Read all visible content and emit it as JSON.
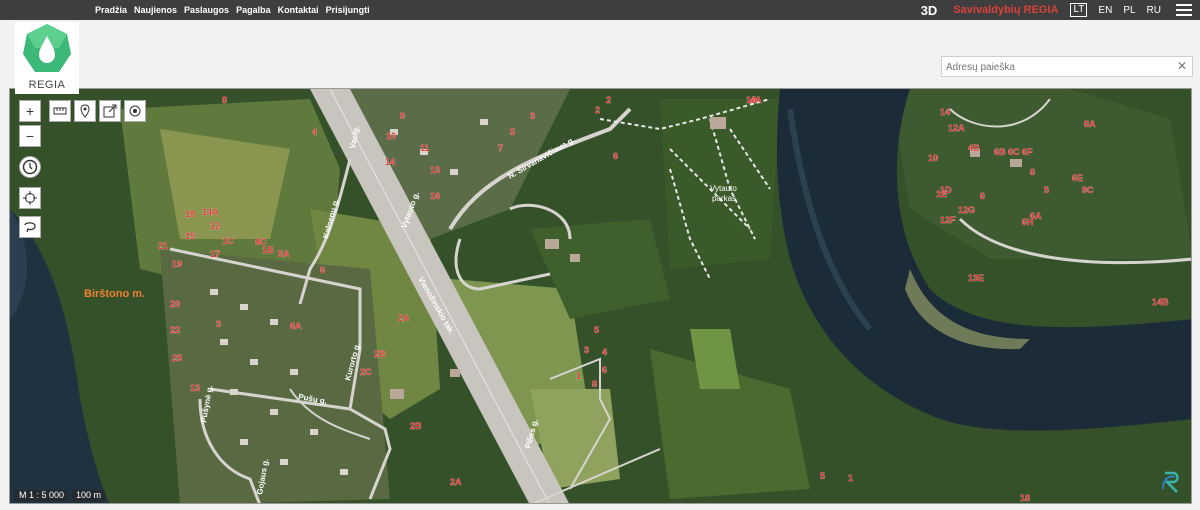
{
  "nav": {
    "items": [
      "Pradžia",
      "Naujienos",
      "Paslaugos",
      "Pagalba",
      "Kontaktai",
      "Prisijungti"
    ]
  },
  "topbar": {
    "btn_3d": "3D",
    "brand": "Savivaldybių REGIA",
    "languages": [
      "LT",
      "EN",
      "PL",
      "RU"
    ],
    "active_language": "LT",
    "menu_icon": "hamburger-icon"
  },
  "logo": {
    "text": "REGIA"
  },
  "search": {
    "placeholder": "Adresų paieška",
    "value": "",
    "clear_icon": "close-icon"
  },
  "map": {
    "tools": [
      "zoom-in-icon",
      "zoom-out-icon",
      "measure-icon",
      "marker-icon",
      "export-icon",
      "locate-icon",
      "history-icon",
      "crosshair-icon",
      "lasso-icon"
    ],
    "zoom_in_symbol": "+",
    "zoom_out_symbol": "−",
    "scale_ratio": "M 1 : 5 000",
    "scale_bar": "100 m",
    "town_label": "Birštono m.",
    "street_labels": [
      "N. Sirvanavičiaus g.",
      "Vaclg.",
      "Vytauto g.",
      "Kalnenų g.",
      "Vilniaus g.",
      "Vienožinskio tak.",
      "Kurorto g.",
      "Pušų g.",
      "Pušynė g.",
      "Gojaus g.",
      "Pilies g."
    ],
    "park_label": [
      "Vytauto",
      "parkas"
    ],
    "house_numbers": [
      "8",
      "4",
      "2",
      "6",
      "4A",
      "3",
      "5",
      "7",
      "11",
      "13",
      "9",
      "10",
      "14",
      "16",
      "18",
      "15",
      "17",
      "19",
      "21",
      "12",
      "14A",
      "1C",
      "1B",
      "5A",
      "8C",
      "6A",
      "6",
      "2A",
      "2B",
      "2C",
      "1",
      "3",
      "5",
      "4",
      "6",
      "8",
      "1A",
      "2",
      "12A",
      "14",
      "1D",
      "10",
      "4B",
      "8A",
      "6C",
      "6B",
      "6F",
      "6E",
      "9C",
      "8",
      "6",
      "5",
      "1E",
      "12F",
      "6H",
      "6A",
      "12G",
      "13E",
      "14B",
      "18",
      "20",
      "22",
      "25",
      "13",
      "3",
      "5",
      "1",
      "2A",
      "2B"
    ],
    "colors": {
      "forest": "#2e4a24",
      "river": "#1c2e3a",
      "field": "#7a8a45",
      "road": "#d7d4cf",
      "house_number": "#e23b3b",
      "town_label": "#f08030"
    }
  }
}
